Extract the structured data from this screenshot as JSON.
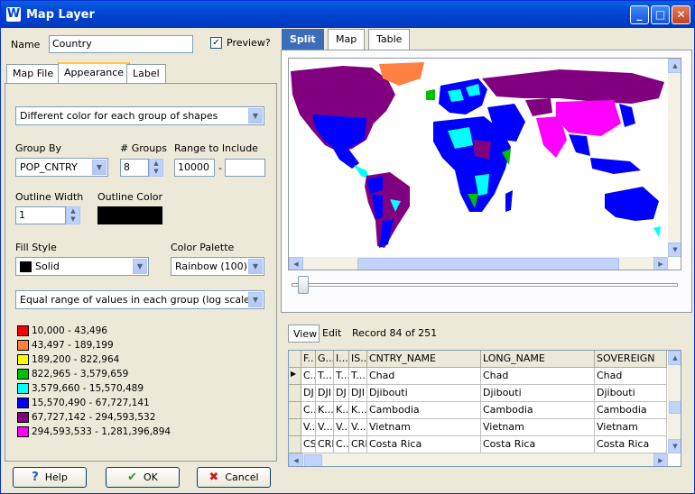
{
  "window": {
    "title": "Map Layer",
    "app_icon": "W"
  },
  "name_field": {
    "label": "Name",
    "value": "Country"
  },
  "preview": {
    "label": "Preview?",
    "checked": true
  },
  "left_tabs": [
    "Map File",
    "Appearance",
    "Label"
  ],
  "appearance": {
    "mode": "Different color for each group of shapes",
    "group_by_label": "Group By",
    "group_by_value": "POP_CNTRY",
    "groups_label": "# Groups",
    "groups_value": "8",
    "range_label": "Range to Include",
    "range_from": "10000",
    "range_sep": "-",
    "range_to": "",
    "outline_width_label": "Outline Width",
    "outline_width_value": "1",
    "outline_color_label": "Outline Color",
    "outline_color": "#000000",
    "fill_style_label": "Fill Style",
    "fill_style_value": "Solid",
    "palette_label": "Color Palette",
    "palette_value": "Rainbow (100)",
    "range_mode": "Equal range of values in each group (log scale)",
    "legend": [
      {
        "label": "10,000 - 43,496",
        "color": "#ff0000"
      },
      {
        "label": "43,497 - 189,199",
        "color": "#ff8040"
      },
      {
        "label": "189,200 - 822,964",
        "color": "#ffff00"
      },
      {
        "label": "822,965 - 3,579,659",
        "color": "#00c000"
      },
      {
        "label": "3,579,660 - 15,570,489",
        "color": "#00ffff"
      },
      {
        "label": "15,570,490 - 67,727,141",
        "color": "#0000ff"
      },
      {
        "label": "67,727,142 - 294,593,532",
        "color": "#800080"
      },
      {
        "label": "294,593,533 - 1,281,396,894",
        "color": "#ff00ff"
      }
    ]
  },
  "buttons": {
    "help": "Help",
    "ok": "OK",
    "cancel": "Cancel"
  },
  "right_tabs": [
    "Split",
    "Map",
    "Table"
  ],
  "table": {
    "view_label": "View",
    "edit_label": "Edit",
    "record_text": "Record 84 of 251",
    "columns": [
      "F..",
      "G...",
      "I...",
      "IS...",
      "CNTRY_NAME",
      "LONG_NAME",
      "SOVEREIGN"
    ],
    "rows": [
      [
        "C..",
        "T...",
        "T...",
        "T...",
        "Chad",
        "Chad",
        "Chad"
      ],
      [
        "DJ",
        "DJI",
        "DJ",
        "DJI",
        "Djibouti",
        "Djibouti",
        "Djibouti"
      ],
      [
        "C..",
        "K...",
        "K...",
        "K...",
        "Cambodia",
        "Cambodia",
        "Cambodia"
      ],
      [
        "V...",
        "V...",
        "V...",
        "V...",
        "Vietnam",
        "Vietnam",
        "Vietnam"
      ],
      [
        "CS",
        "CRI",
        "C...",
        "CRI",
        "Costa Rica",
        "Costa Rica",
        "Costa Rica"
      ]
    ]
  }
}
